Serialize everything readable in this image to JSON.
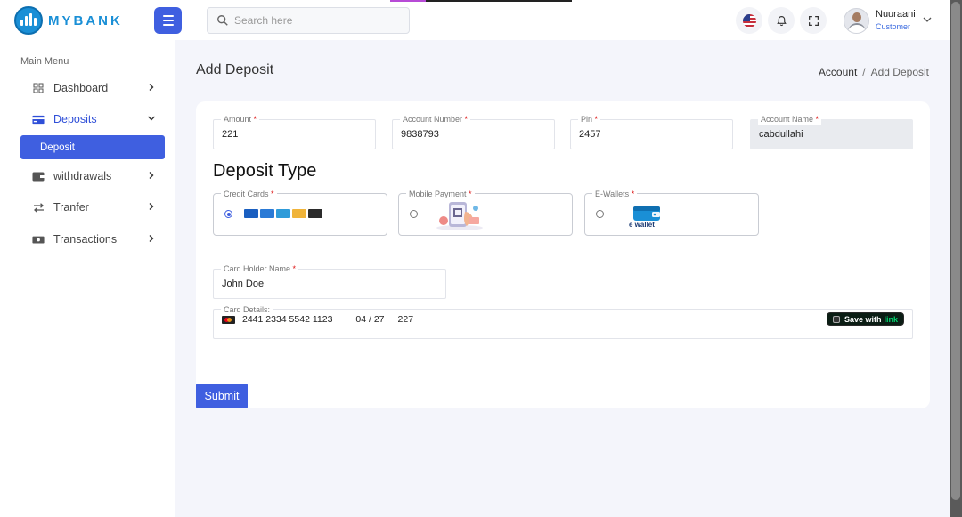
{
  "app": {
    "brand": "MYBANK"
  },
  "header": {
    "search_placeholder": "Search here",
    "user": {
      "name": "Nuuraani",
      "role": "Customer"
    }
  },
  "sidebar": {
    "title": "Main Menu",
    "items": [
      {
        "label": "Dashboard",
        "icon": "grid-icon",
        "chevron": "right"
      },
      {
        "label": "Deposits",
        "icon": "card-icon",
        "chevron": "down",
        "active": true
      },
      {
        "label": "withdrawals",
        "icon": "wallet-icon",
        "chevron": "right"
      },
      {
        "label": "Tranfer",
        "icon": "transfer-icon",
        "chevron": "right"
      },
      {
        "label": "Transactions",
        "icon": "cash-icon",
        "chevron": "right"
      }
    ],
    "sub_item": "Deposit"
  },
  "page": {
    "title": "Add Deposit",
    "breadcrumb": {
      "parent": "Account",
      "separator": "/",
      "current": "Add Deposit"
    }
  },
  "form": {
    "amount": {
      "label": "Amount",
      "value": "221"
    },
    "account_number": {
      "label": "Account Number",
      "value": "9838793"
    },
    "pin": {
      "label": "Pin",
      "value": "2457"
    },
    "account_name": {
      "label": "Account Name",
      "value": "cabdullahi"
    },
    "required_mark": "*",
    "deposit_type_title": "Deposit Type",
    "deposit_types": [
      {
        "label": "Credit Cards",
        "selected": true
      },
      {
        "label": "Mobile Payment",
        "selected": false
      },
      {
        "label": "E-Wallets",
        "selected": false,
        "art_label": "e wallet"
      }
    ],
    "card_holder": {
      "label": "Card Holder Name",
      "value": "John Doe"
    },
    "card_details": {
      "label": "Card Details:",
      "number": "2441 2334 5542 1123",
      "expiry": "04 / 27",
      "cvc": "227",
      "save_text": "Save with",
      "save_link": "link"
    },
    "submit_label": "Submit"
  },
  "colors": {
    "primary": "#3f5fe0",
    "brand": "#1a8fd6",
    "required": "#dd1111",
    "link_green": "#00d66f"
  }
}
